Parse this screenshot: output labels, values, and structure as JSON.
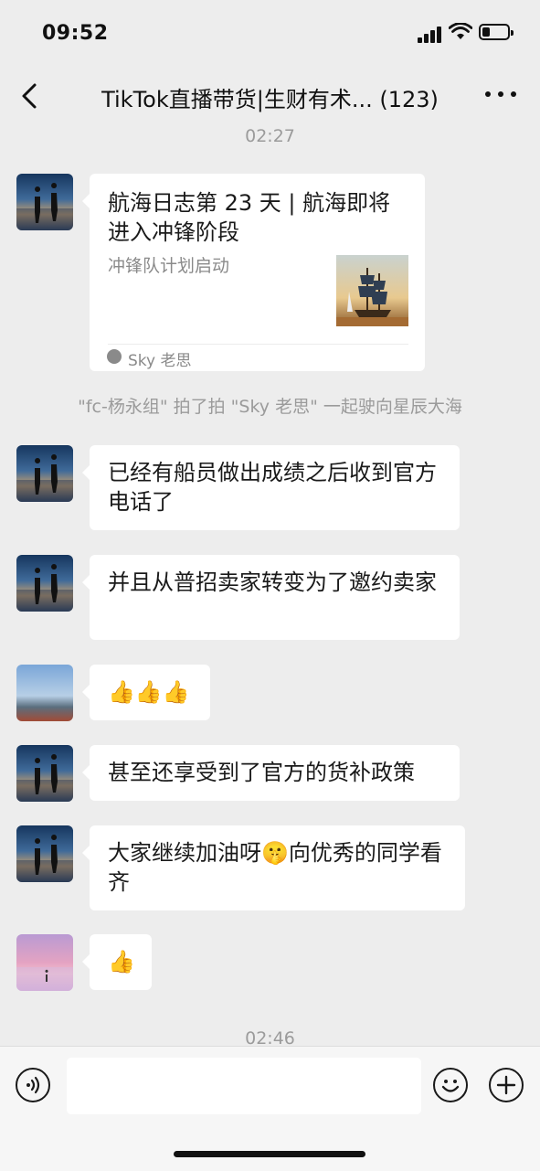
{
  "status_bar": {
    "time": "09:52"
  },
  "header": {
    "title": "TikTok直播带货|生财有术... (123)"
  },
  "timestamps": {
    "top": "02:27",
    "bottom": "02:46"
  },
  "link_card": {
    "title": "航海日志第 23 天 | 航海即将进入冲锋阶段",
    "description": "冲锋队计划启动",
    "source": "Sky 老思"
  },
  "system_message": "\"fc-杨永组\" 拍了拍 \"Sky 老思\" 一起驶向星辰大海",
  "messages": [
    {
      "text": "已经有船员做出成绩之后收到官方电话了"
    },
    {
      "text": "并且从普招卖家转变为了邀约卖家"
    },
    {
      "text": "👍👍👍"
    },
    {
      "text": "甚至还享受到了官方的货补政策"
    },
    {
      "text": "大家继续加油呀🤫向优秀的同学看齐"
    },
    {
      "text": "👍"
    }
  ],
  "input": {
    "placeholder": ""
  },
  "icons": [
    "back-arrow-icon",
    "more-icon",
    "voice-icon",
    "emoji-icon",
    "plus-icon",
    "signal-icon",
    "wifi-icon",
    "battery-icon"
  ]
}
